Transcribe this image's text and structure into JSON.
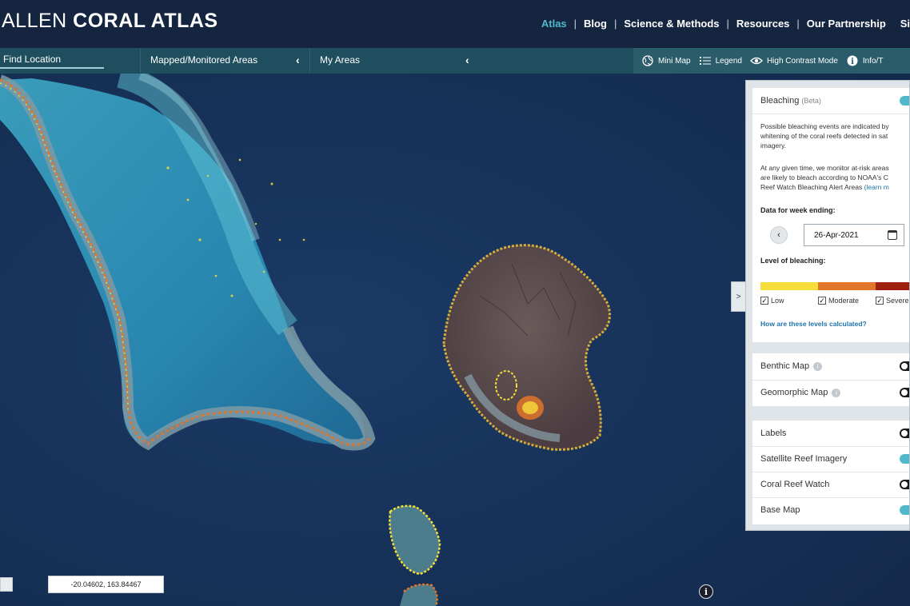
{
  "header": {
    "brand_light": "ALLEN",
    "brand_bold": "CORAL ATLAS",
    "nav": [
      {
        "label": "Atlas",
        "active": true
      },
      {
        "label": "Blog"
      },
      {
        "label": "Science & Methods"
      },
      {
        "label": "Resources"
      },
      {
        "label": "Our Partnership"
      },
      {
        "label": "Sig"
      }
    ],
    "separator": "|"
  },
  "toolbar": {
    "find_location": "Find Location",
    "mapped_areas": "Mapped/Monitored Areas",
    "my_areas": "My Areas",
    "collapse_glyph": "‹",
    "buttons": [
      {
        "label": "Mini Map",
        "icon": "globe-icon"
      },
      {
        "label": "Legend",
        "icon": "list-icon"
      },
      {
        "label": "High Contrast Mode",
        "icon": "eye-icon"
      },
      {
        "label": "Info/T",
        "icon": "info-icon"
      }
    ]
  },
  "panel": {
    "collapse_glyph": ">",
    "bleaching": {
      "title": "Bleaching",
      "badge": "(Beta)",
      "enabled": true,
      "desc1_lines": [
        "Possible bleaching events are indicated by",
        "whitening of the coral reefs detected in sat",
        "imagery."
      ],
      "desc2_lines": [
        "At any given time, we monitor at-risk areas",
        "are likely to bleach according to NOAA's C",
        "Reef Watch Bleaching Alert Areas"
      ],
      "desc2_link": "(learn m",
      "week_label": "Data for week ending:",
      "date_prev_glyph": "‹",
      "date_value": "26-Apr-2021",
      "level_label": "Level of bleaching:",
      "levels": [
        {
          "label": "Low",
          "checked": true,
          "color": "#f5dd3a"
        },
        {
          "label": "Moderate",
          "checked": true,
          "color": "#e0762a"
        },
        {
          "label": "Severe",
          "checked": true,
          "color": "#9e1e0f"
        }
      ],
      "check_glyph": "✓",
      "calc_link": "How are these levels calculated?"
    },
    "maps": [
      {
        "label": "Benthic Map",
        "enabled": false,
        "help": "i"
      },
      {
        "label": "Geomorphic Map",
        "enabled": false,
        "help": "i"
      }
    ],
    "layers": [
      {
        "label": "Labels",
        "enabled": false
      },
      {
        "label": "Satellite Reef Imagery",
        "enabled": true
      },
      {
        "label": "Coral Reef Watch",
        "enabled": false
      },
      {
        "label": "Base Map",
        "enabled": true
      }
    ]
  },
  "map": {
    "coordinates": "-20.04602, 163.84467",
    "info_glyph": "i"
  },
  "colors": {
    "accent": "#4fb8c9",
    "header_bg": "#152540",
    "toolbar_bg": "#1f4f5e",
    "ocean": "#13284a"
  }
}
